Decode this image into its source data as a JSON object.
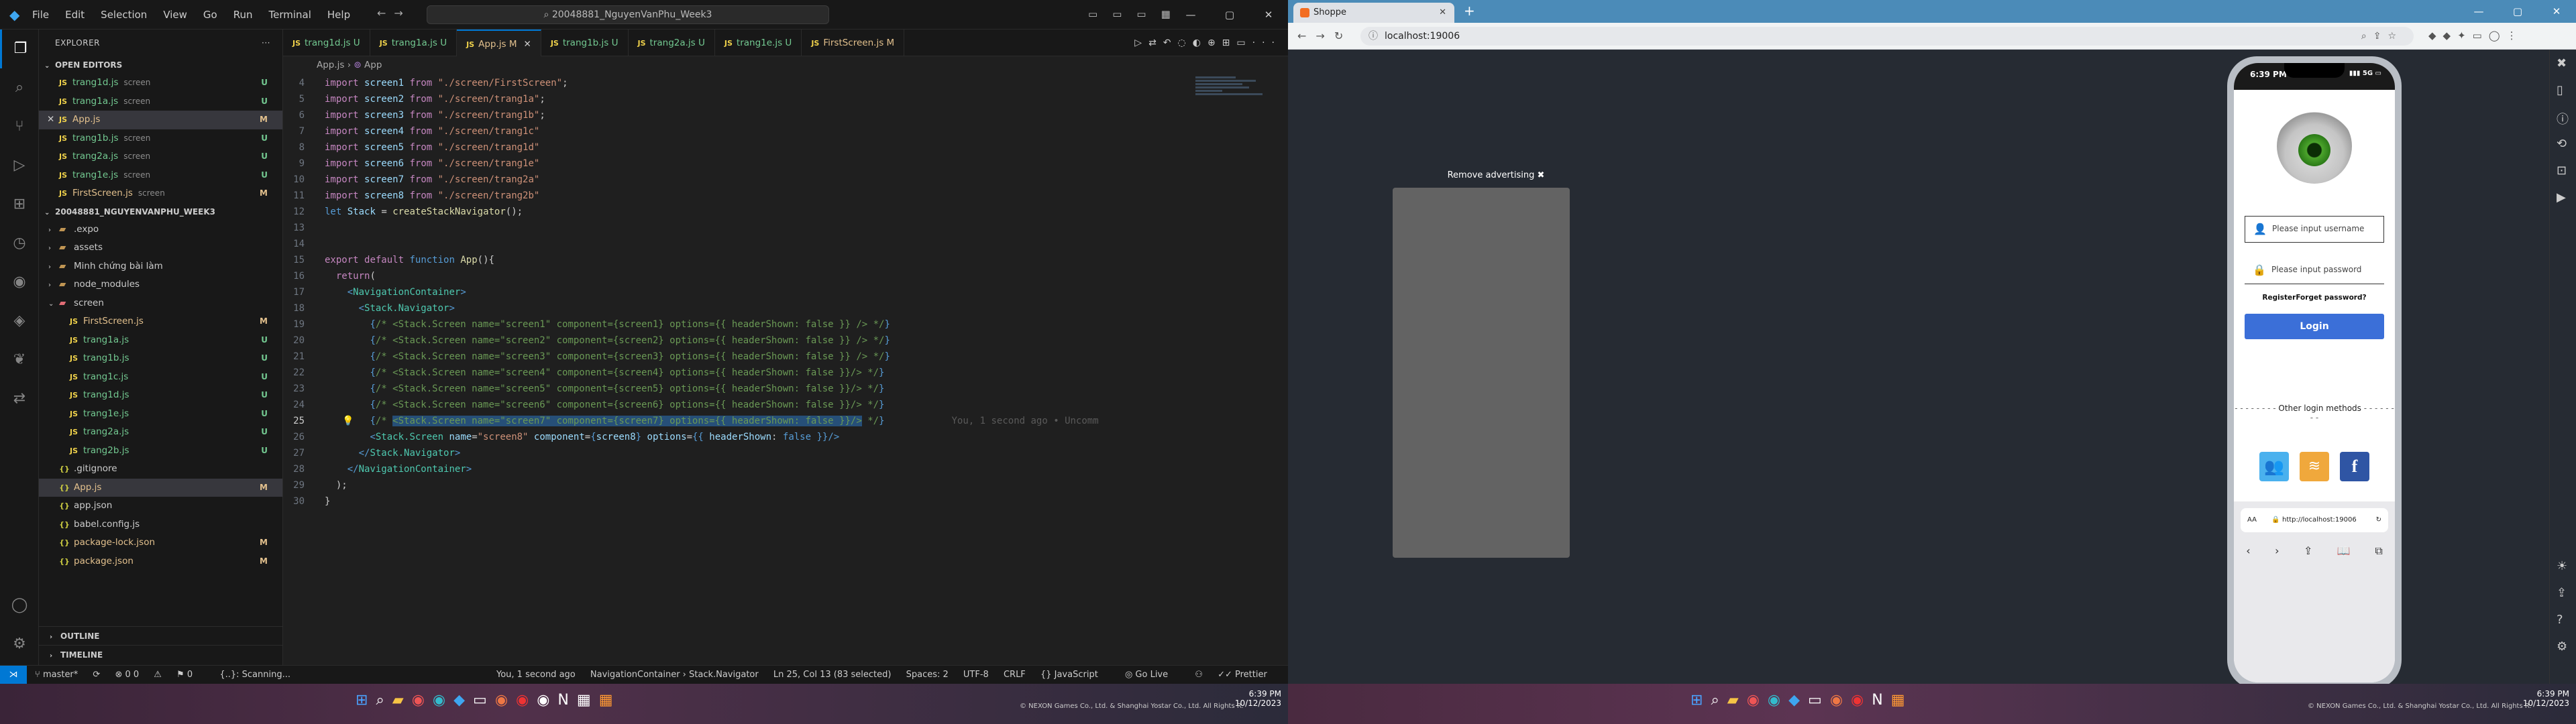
{
  "vscode": {
    "menu": [
      "File",
      "Edit",
      "Selection",
      "View",
      "Go",
      "Run",
      "Terminal",
      "Help"
    ],
    "command_center": "20048881_NguyenVanPhu_Week3",
    "explorer_title": "EXPLORER",
    "open_editors_title": "OPEN EDITORS",
    "open_editors": [
      {
        "name": "trang1d.js",
        "desc": "screen",
        "status": "U"
      },
      {
        "name": "trang1a.js",
        "desc": "screen",
        "status": "U"
      },
      {
        "name": "App.js",
        "desc": "",
        "status": "M"
      },
      {
        "name": "trang1b.js",
        "desc": "screen",
        "status": "U"
      },
      {
        "name": "trang2a.js",
        "desc": "screen",
        "status": "U"
      },
      {
        "name": "trang1e.js",
        "desc": "screen",
        "status": "U"
      },
      {
        "name": "FirstScreen.js",
        "desc": "screen",
        "status": "M"
      }
    ],
    "project_title": "20048881_NGUYENVANPHU_WEEK3",
    "tree": [
      {
        "name": ".expo",
        "type": "folder"
      },
      {
        "name": "assets",
        "type": "folder"
      },
      {
        "name": "Minh chứng bài làm",
        "type": "folder"
      },
      {
        "name": "node_modules",
        "type": "folder"
      },
      {
        "name": "screen",
        "type": "folder-open"
      },
      {
        "name": "FirstScreen.js",
        "type": "file",
        "status": "M"
      },
      {
        "name": "trang1a.js",
        "type": "file",
        "status": "U"
      },
      {
        "name": "trang1b.js",
        "type": "file",
        "status": "U"
      },
      {
        "name": "trang1c.js",
        "type": "file",
        "status": "U"
      },
      {
        "name": "trang1d.js",
        "type": "file",
        "status": "U"
      },
      {
        "name": "trang1e.js",
        "type": "file",
        "status": "U"
      },
      {
        "name": "trang2a.js",
        "type": "file",
        "status": "U"
      },
      {
        "name": "trang2b.js",
        "type": "file",
        "status": "U"
      },
      {
        "name": ".gitignore",
        "type": "root"
      },
      {
        "name": "App.js",
        "type": "root",
        "status": "M"
      },
      {
        "name": "app.json",
        "type": "root"
      },
      {
        "name": "babel.config.js",
        "type": "root"
      },
      {
        "name": "package-lock.json",
        "type": "root",
        "status": "M"
      },
      {
        "name": "package.json",
        "type": "root",
        "status": "M"
      }
    ],
    "outline": "OUTLINE",
    "timeline": "TIMELINE",
    "tabs": [
      {
        "name": "trang1d.js",
        "flag": "U"
      },
      {
        "name": "trang1a.js",
        "flag": "U"
      },
      {
        "name": "App.js",
        "flag": "M",
        "active": true
      },
      {
        "name": "trang1b.js",
        "flag": "U"
      },
      {
        "name": "trang2a.js",
        "flag": "U"
      },
      {
        "name": "trang1e.js",
        "flag": "U"
      },
      {
        "name": "FirstScreen.js",
        "flag": "M"
      }
    ],
    "breadcrumb": [
      "App.js",
      "App"
    ],
    "blame": "You, 1 second ago • Uncomm",
    "status": {
      "branch": "master*",
      "problems": "0 0",
      "warnings": "0",
      "scanning": "{..}: Scanning...",
      "blame": "You, 1 second ago",
      "context": "NavigationContainer › Stack.Navigator",
      "position": "Ln 25, Col 13 (83 selected)",
      "spaces": "Spaces: 2",
      "encoding": "UTF-8",
      "eol": "CRLF",
      "language": "JavaScript",
      "golive": "Go Live",
      "prettier": "Prettier"
    }
  },
  "browser": {
    "tab_title": "Shoppe",
    "url": "localhost:19006",
    "remove_ad": "Remove advertising",
    "phone": {
      "time": "6:39 PM",
      "signal": "5G",
      "username_placeholder": "Please input username",
      "password_placeholder": "Please input password",
      "register": "Register",
      "forget": "Forget password?",
      "login": "Login",
      "other": "Other login methods",
      "aa": "AA",
      "bottom_url": "http://localhost:19006"
    }
  },
  "taskbar_left": {
    "time": "6:39 PM",
    "date": "10/12/2023",
    "copyright": "© NEXON Games Co., Ltd. & Shanghai Yostar Co., Ltd. All Rights R."
  },
  "taskbar_right": {
    "time": "6:39 PM",
    "date": "10/12/2023",
    "copyright": "© NEXON Games Co., Ltd. & Shanghai Yostar Co., Ltd. All Rights R."
  }
}
